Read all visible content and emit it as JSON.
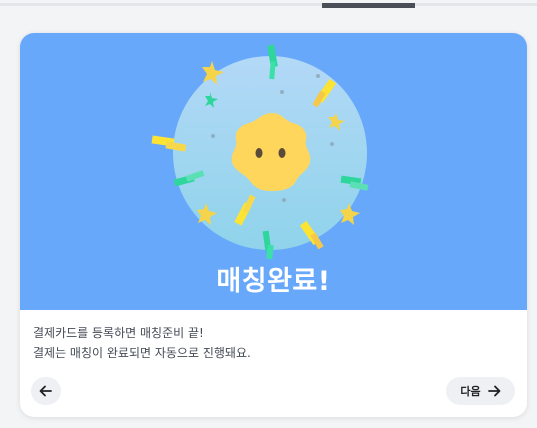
{
  "hero": {
    "title": "매칭완료!"
  },
  "description": {
    "line1": "결제카드를 등록하면 매칭준비 끝!",
    "line2": "결제는 매칭이 완료되면 자동으로 진행돼요."
  },
  "navigation": {
    "prev_icon": "arrow-left-icon",
    "next_label": "다음",
    "next_icon": "arrow-right-icon"
  },
  "colors": {
    "hero_background": "#68a8fb",
    "circle": "#a9d8f3",
    "face": "#ffd65c",
    "confetti_yellow": "#fde333",
    "confetti_green": "#2ed69c"
  }
}
